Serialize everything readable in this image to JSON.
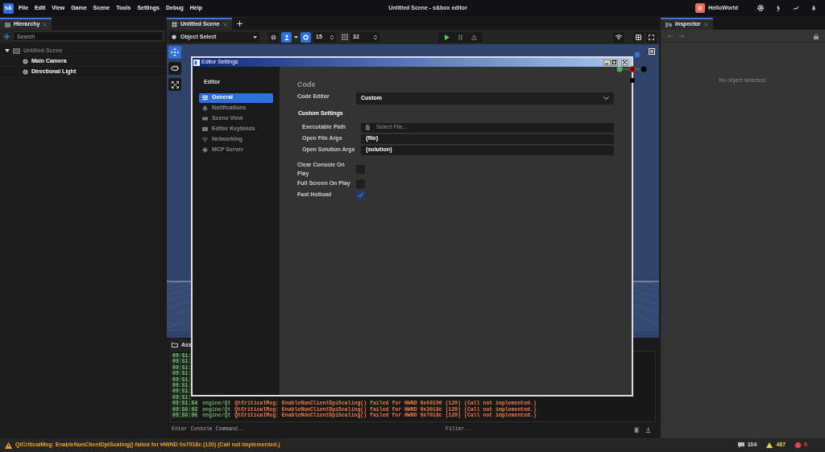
{
  "app": {
    "logo": "s&",
    "menu": [
      "File",
      "Edit",
      "View",
      "Game",
      "Scene",
      "Tools",
      "Settings",
      "Debug",
      "Help"
    ],
    "title": "Untitled Scene - s&box editor",
    "user": "HelloWorld"
  },
  "hierarchy": {
    "tab": "Hierarchy",
    "search_placeholder": "Search",
    "tree": [
      {
        "label": "Untitled Scene",
        "expanded": true,
        "children": [
          {
            "label": "Main Camera"
          },
          {
            "label": "Directional Light"
          }
        ]
      }
    ]
  },
  "scene": {
    "tab": "Untitled Scene",
    "mode": "Object Select",
    "snap_angle": "15",
    "grid_size": "32"
  },
  "inspector": {
    "tab": "Inspector",
    "empty_text": "No object selected."
  },
  "console": {
    "tab": "Ass",
    "lines": [
      {
        "time": "09:51:"
      },
      {
        "time": "09:51:"
      },
      {
        "time": "09:51:"
      },
      {
        "time": "09:51:"
      },
      {
        "time": "09:51:"
      },
      {
        "time": "09:51:"
      },
      {
        "time": "09:51:"
      },
      {
        "time": "09:51:"
      },
      {
        "time": "09:51:54",
        "source": "engine/Qt",
        "message": "QtCriticalMsg: EnableNonClientDpiScaling() failed for HWND 0x60190 (120) (Call not implemented.)"
      },
      {
        "time": "09:56:02",
        "source": "engine/Qt",
        "message": "QtCriticalMsg: EnableNonClientDpiScaling() failed for HWND 0x3018c (120) (Call not implemented.)"
      },
      {
        "time": "09:56:06",
        "source": "engine/Qt",
        "message": "QtCriticalMsg: EnableNonClientDpiScaling() failed for HWND 0x7018c (120) (Call not implemented.)"
      }
    ],
    "command_placeholder": "Enter Console Command..",
    "filter_placeholder": "Filter.."
  },
  "dialog": {
    "title": "Editor Settings",
    "section": "Editor",
    "nav": [
      {
        "label": "General",
        "selected": true
      },
      {
        "label": "Notifications",
        "selected": false
      },
      {
        "label": "Scene View",
        "selected": false
      },
      {
        "label": "Editor Keybinds",
        "selected": false
      },
      {
        "label": "Networking",
        "selected": false
      },
      {
        "label": "MCP Server",
        "selected": false
      }
    ],
    "heading": "Code",
    "code_editor": {
      "label": "Code Editor",
      "value": "Custom"
    },
    "subheading": "Custom Settings",
    "custom_fields": [
      {
        "label": "Executable Path",
        "placeholder": "Select File..."
      },
      {
        "label": "Open File Args",
        "value": "{file}"
      },
      {
        "label": "Open Solution Args",
        "value": "{solution}"
      }
    ],
    "checkboxes": [
      {
        "label": "Clear Console On Play",
        "checked": false
      },
      {
        "label": "Full Screen On Play",
        "checked": false
      },
      {
        "label": "Fast Hotload",
        "checked": true
      }
    ]
  },
  "status": {
    "message": "QtCriticalMsg: EnableNonClientDpiScaling() failed for HWND 0x7018c (120) (Call not implemented.)",
    "messages": "104",
    "warnings": "487",
    "errors": "0"
  }
}
